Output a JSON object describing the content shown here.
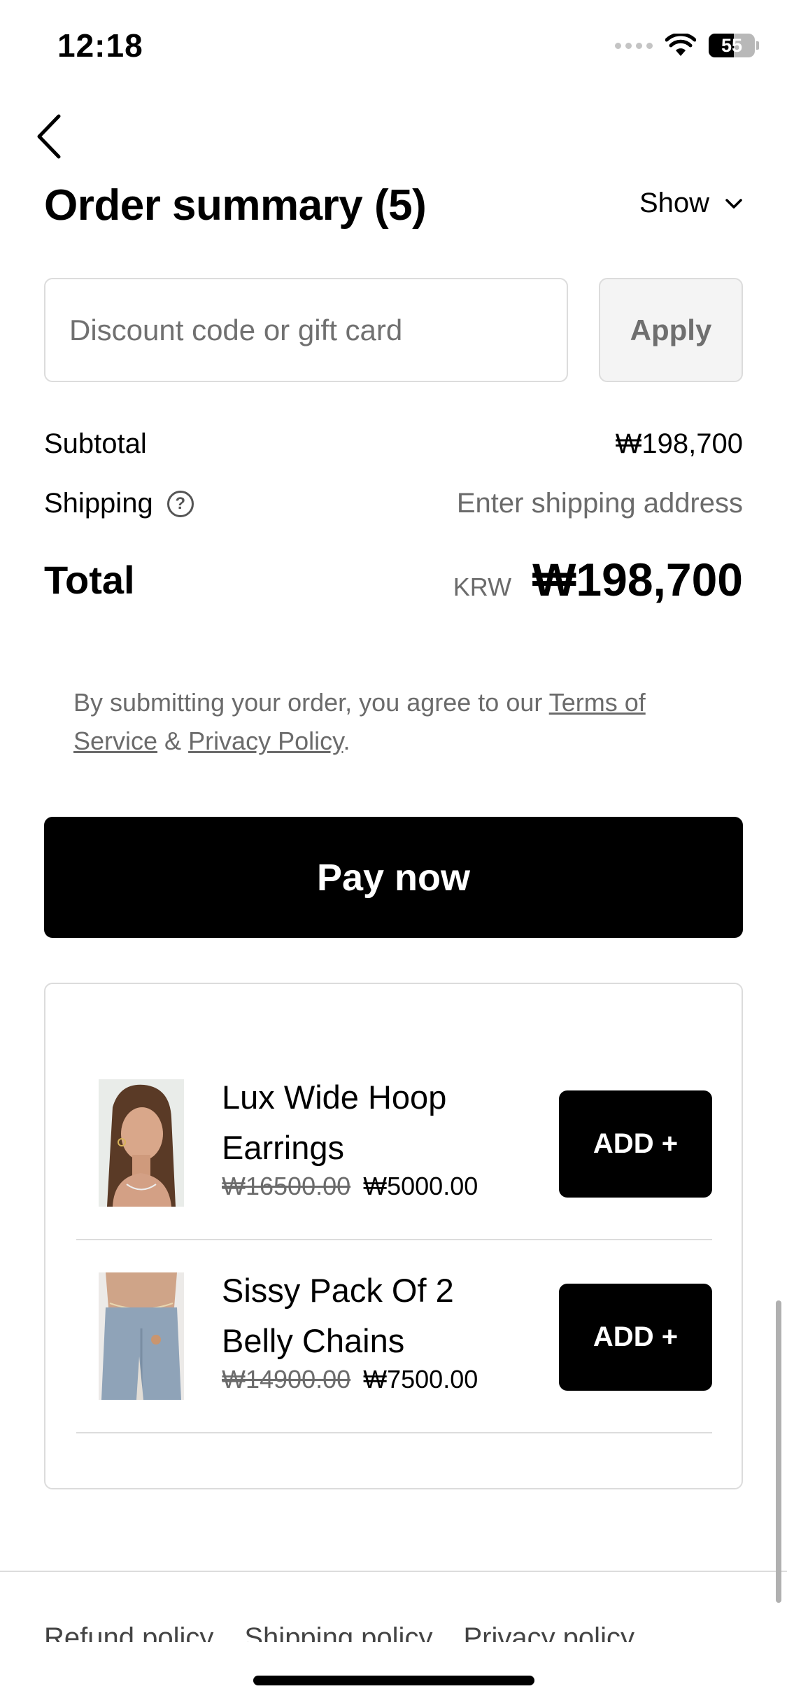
{
  "status_bar": {
    "time": "12:18",
    "battery_level": "55"
  },
  "header": {
    "title": "Order summary (5)",
    "show_label": "Show"
  },
  "discount": {
    "placeholder": "Discount code or gift card",
    "apply_label": "Apply"
  },
  "summary": {
    "subtotal_label": "Subtotal",
    "subtotal_value": "₩198,700",
    "shipping_label": "Shipping",
    "shipping_value": "Enter shipping address",
    "total_label": "Total",
    "total_currency": "KRW",
    "total_value": "₩198,700"
  },
  "terms": {
    "prefix": "By submitting your order, you agree to our ",
    "terms_link": "Terms of Service",
    "amp": " & ",
    "privacy_link": "Privacy Policy",
    "suffix": "."
  },
  "pay_label": "Pay now",
  "upsell": {
    "items": [
      {
        "name": "Lux Wide Hoop Earrings",
        "old_price": "₩16500.00",
        "price": "₩5000.00",
        "add_label": "ADD +"
      },
      {
        "name": "Sissy Pack Of 2 Belly Chains",
        "old_price": "₩14900.00",
        "price": "₩7500.00",
        "add_label": "ADD +"
      }
    ]
  },
  "footer_links": [
    "Refund policy",
    "Shipping policy",
    "Privacy policy"
  ]
}
